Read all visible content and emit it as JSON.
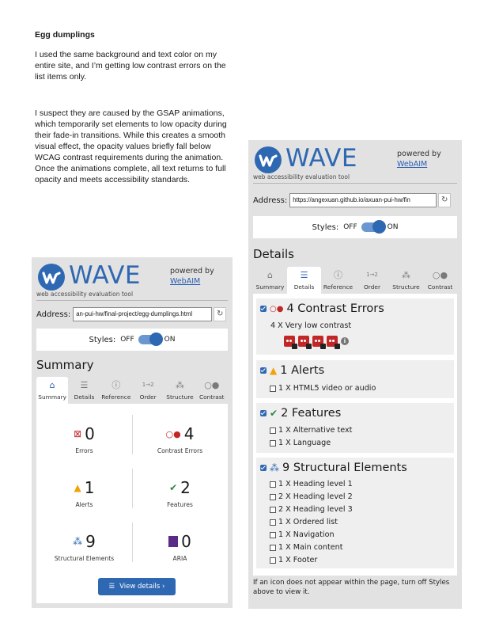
{
  "document": {
    "title": "Egg dumplings",
    "paragraph_1": "I used the same background and text color on my entire site, and I’m getting low contrast errors on the list items only.",
    "paragraph_2": "I suspect they are caused by the GSAP animations, which temporarily set elements to low opacity during their fade-in transitions. While this creates a smooth visual effect, the opacity values briefly fall below WCAG contrast requirements during the animation. Once the animations complete, all text returns to full opacity and meets accessibility standards."
  },
  "wave_common": {
    "wordmark": "WAVE",
    "subtitle": "web accessibility evaluation tool",
    "powered_by": "powered by",
    "webaim_link": "WebAIM",
    "address_label": "Address:",
    "styles_label": "Styles:",
    "styles_off": "OFF",
    "styles_on": "ON",
    "tabs": [
      "Summary",
      "Details",
      "Reference",
      "Order",
      "Structure",
      "Contrast"
    ],
    "colors": {
      "brand_blue": "#2f68b2",
      "error_red": "#c22727",
      "alert_orange": "#f0a30a",
      "feature_green": "#2e8540",
      "aria_purple": "#5b2a86"
    }
  },
  "left_panel": {
    "address_value": "an-pui-hw/final-project/egg-dumplings.html",
    "section_title": "Summary",
    "active_tab": "Summary",
    "summary": {
      "errors": {
        "count": "0",
        "label": "Errors"
      },
      "contrast_errors": {
        "count": "4",
        "label": "Contrast Errors"
      },
      "alerts": {
        "count": "1",
        "label": "Alerts"
      },
      "features": {
        "count": "2",
        "label": "Features"
      },
      "structural": {
        "count": "9",
        "label": "Structural Elements"
      },
      "aria": {
        "count": "0",
        "label": "ARIA"
      }
    },
    "view_details_label": "View details ›"
  },
  "right_panel": {
    "address_value": "https://angexuan.github.io/axuan-pui-hw/fin",
    "section_title": "Details",
    "active_tab": "Details",
    "groups": {
      "contrast": {
        "title": "4 Contrast Errors",
        "items": [
          "4 X Very low contrast"
        ]
      },
      "alerts": {
        "title": "1 Alerts",
        "items": [
          "1 X HTML5 video or audio"
        ]
      },
      "features": {
        "title": "2 Features",
        "items": [
          "1 X Alternative text",
          "1 X Language"
        ]
      },
      "structural": {
        "title": "9 Structural Elements",
        "items": [
          "1 X Heading level 1",
          "2 X Heading level 2",
          "2 X Heading level 3",
          "1 X Ordered list",
          "1 X Navigation",
          "1 X Main content",
          "1 X Footer"
        ]
      }
    },
    "footer_note": "If an icon does not appear within the page, turn off Styles above to view it."
  }
}
